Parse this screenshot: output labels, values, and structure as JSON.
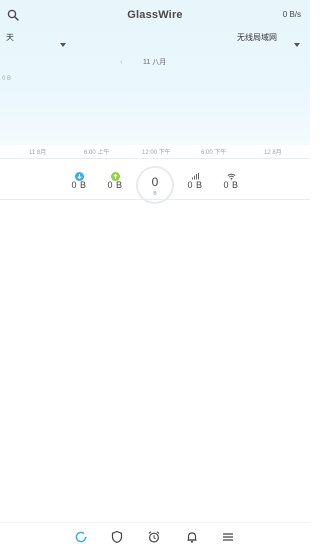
{
  "header": {
    "title": "GlassWire",
    "rate": "0 B/s"
  },
  "filters": {
    "period": "天",
    "network": "无线局域网"
  },
  "date_nav": {
    "date": "11 八月"
  },
  "graph": {
    "y_label": "0 B",
    "timeline_ticks": [
      "11 8月",
      "6:00 上午",
      "12:00 下午",
      "6:00 下午",
      "12 8月"
    ]
  },
  "stats": {
    "download": "0 B",
    "upload": "0 B",
    "dial_value": "0",
    "dial_unit": "B",
    "mobile": "0 B",
    "wifi": "0 B"
  },
  "colors": {
    "download_icon": "#3aaee8",
    "upload_icon": "#8ed23f",
    "active_nav": "#3aaee8",
    "inactive_nav": "#444444"
  },
  "bottom_nav": [
    "graph-icon",
    "shield-icon",
    "alarm-icon",
    "bell-icon",
    "menu-icon"
  ]
}
